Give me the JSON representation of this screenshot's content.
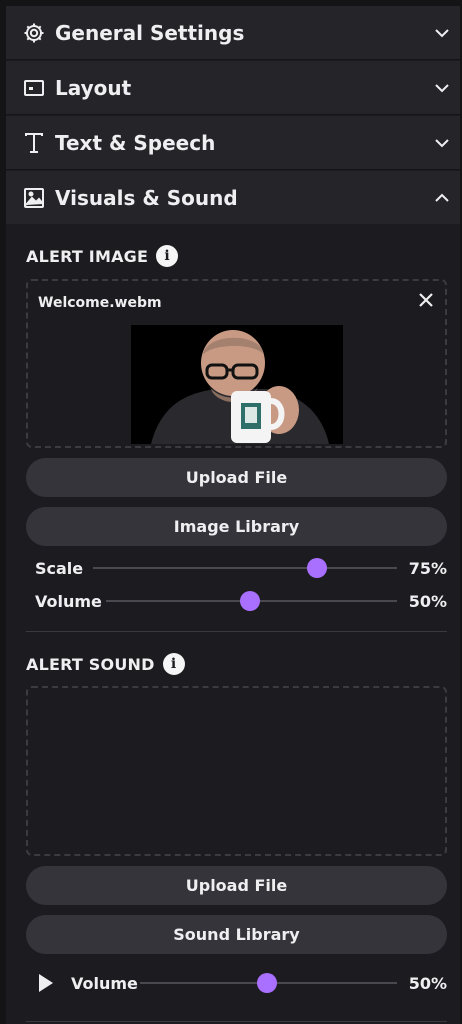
{
  "accordion": [
    {
      "label": "General Settings",
      "icon": "gear-icon",
      "expanded": false
    },
    {
      "label": "Layout",
      "icon": "layout-icon",
      "expanded": false
    },
    {
      "label": "Text & Speech",
      "icon": "text-icon",
      "expanded": false
    },
    {
      "label": "Visuals & Sound",
      "icon": "image-icon",
      "expanded": true
    }
  ],
  "alert_image": {
    "title": "ALERT IMAGE",
    "file_name": "Welcome.webm",
    "upload_label": "Upload File",
    "library_label": "Image Library",
    "scale": {
      "label": "Scale",
      "value": 75,
      "value_text": "75%"
    },
    "volume": {
      "label": "Volume",
      "value": 50,
      "value_text": "50%"
    }
  },
  "alert_sound": {
    "title": "ALERT SOUND",
    "upload_label": "Upload File",
    "library_label": "Sound Library",
    "volume": {
      "label": "Volume",
      "value": 50,
      "value_text": "50%"
    }
  },
  "colors": {
    "accent": "#a970ff",
    "panel": "#252429",
    "background": "#1c1b1f"
  }
}
